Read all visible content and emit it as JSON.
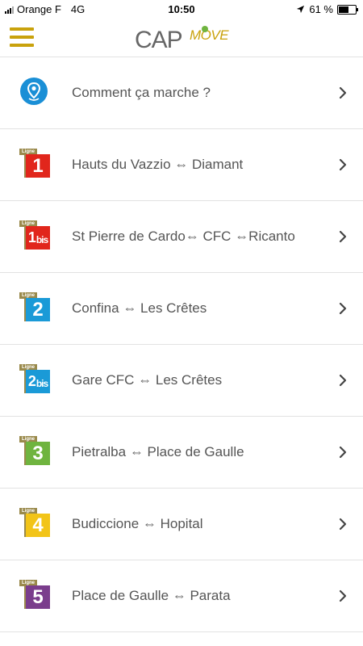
{
  "status_bar": {
    "carrier": "Orange F",
    "network": "4G",
    "time": "10:50",
    "battery_text": "61 %",
    "battery_level": 0.61
  },
  "header": {
    "logo_left": "CAP",
    "logo_right": "MOVE",
    "colors": {
      "brand": "#c9a20c",
      "logo_dark": "#666666"
    }
  },
  "rows": [
    {
      "label": "Comment ça marche ?",
      "icon": "location-pin-icon"
    },
    {
      "label": "Hauts du Vazzio ⇔ Diamant",
      "icon": "line-1-icon",
      "tag": "Ligne",
      "num": "1",
      "bis": "",
      "color": "#e1261c"
    },
    {
      "label": "St Pierre de Cardo⇔ CFC ⇔Ricanto",
      "icon": "line-1bis-icon",
      "tag": "Ligne",
      "num": "1",
      "bis": "bis",
      "color": "#e1261c"
    },
    {
      "label": "Confina ⇔ Les Crêtes",
      "icon": "line-2-icon",
      "tag": "Ligne",
      "num": "2",
      "bis": "",
      "color": "#1a9ad7"
    },
    {
      "label": "Gare CFC ⇔ Les Crêtes",
      "icon": "line-2bis-icon",
      "tag": "Ligne",
      "num": "2",
      "bis": "bis",
      "color": "#1a9ad7"
    },
    {
      "label": "Pietralba ⇔ Place de Gaulle",
      "icon": "line-3-icon",
      "tag": "Ligne",
      "num": "3",
      "bis": "",
      "color": "#6fb43f"
    },
    {
      "label": "Budiccione ⇔ Hopital",
      "icon": "line-4-icon",
      "tag": "Ligne",
      "num": "4",
      "bis": "",
      "color": "#f2c418"
    },
    {
      "label": "Place de Gaulle ⇔ Parata",
      "icon": "line-5-icon",
      "tag": "Ligne",
      "num": "5",
      "bis": "",
      "color": "#7a3d8c"
    }
  ]
}
